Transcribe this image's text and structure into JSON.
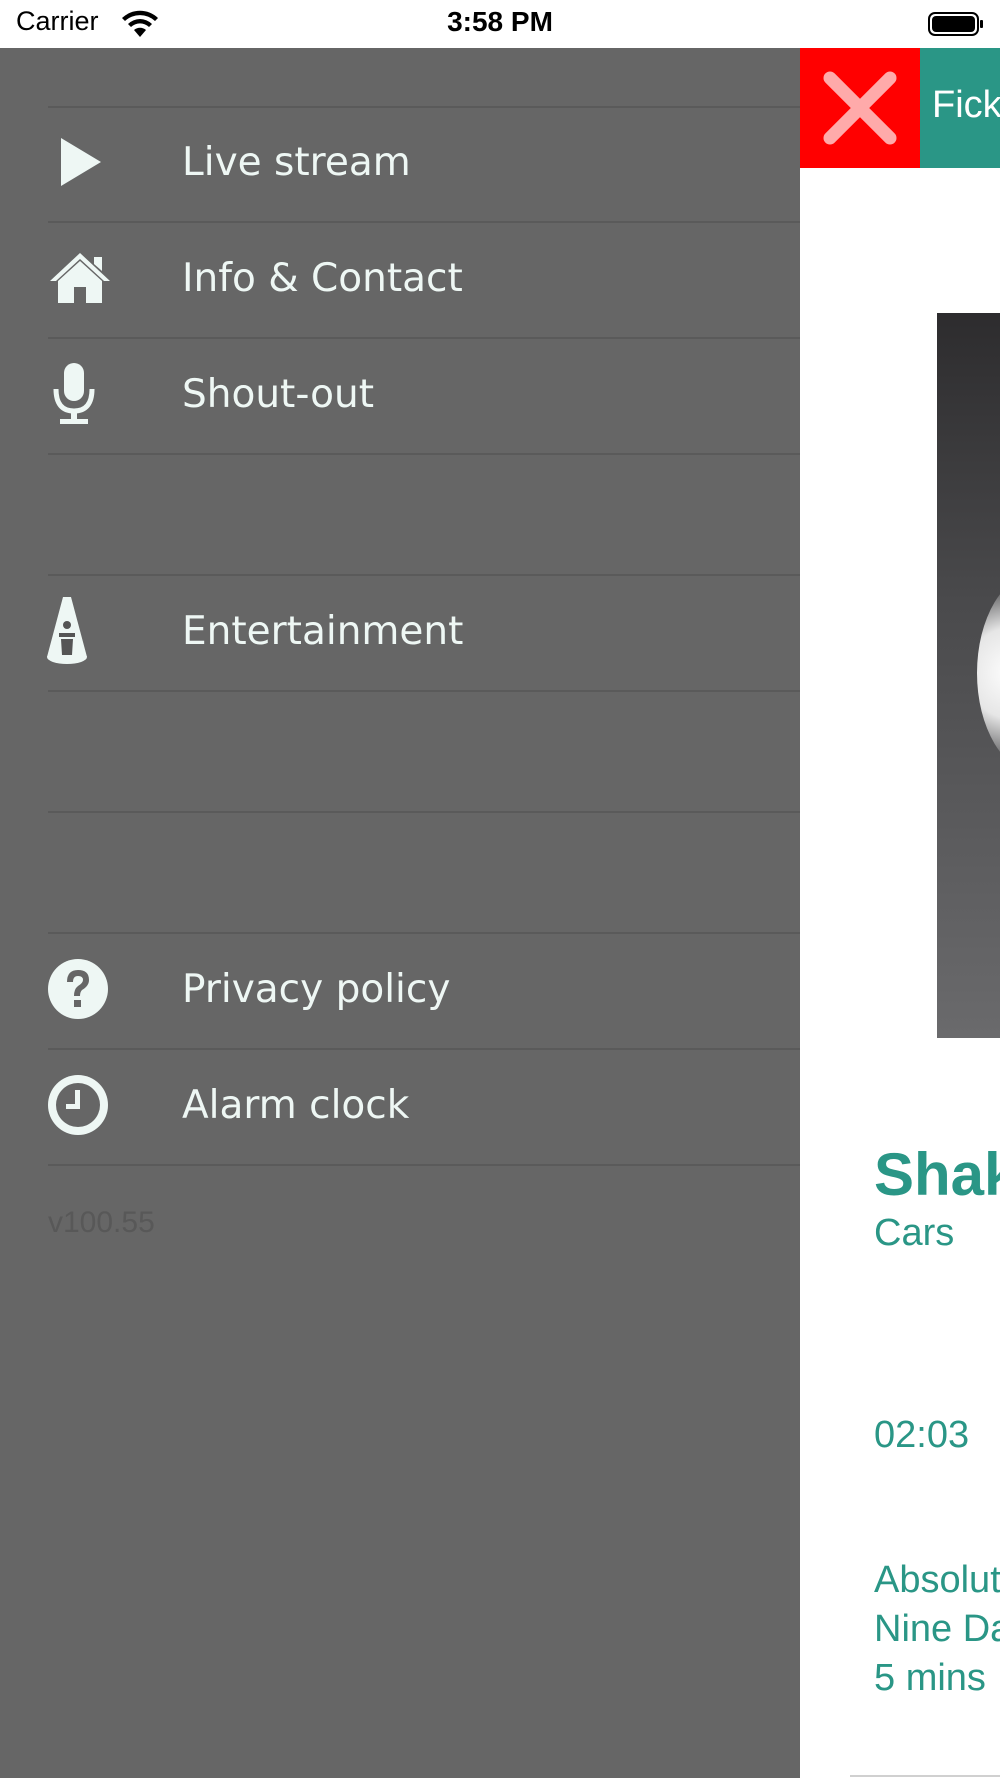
{
  "status_bar": {
    "carrier": "Carrier",
    "time": "3:58 PM"
  },
  "drawer": {
    "menu": [
      {
        "label": "Live stream",
        "icon": "play-icon"
      },
      {
        "label": "Info & Contact",
        "icon": "home-icon"
      },
      {
        "label": "Shout-out",
        "icon": "microphone-icon"
      },
      {
        "label": "",
        "icon": ""
      },
      {
        "label": "Entertainment",
        "icon": "spotlight-performer-icon"
      },
      {
        "label": "",
        "icon": ""
      },
      {
        "label": "",
        "icon": ""
      },
      {
        "label": "Privacy policy",
        "icon": "question-circle-icon"
      },
      {
        "label": "Alarm clock",
        "icon": "clock-icon"
      }
    ],
    "version": "v100.55"
  },
  "content": {
    "title_partial": "Fick",
    "now_playing": {
      "title_partial": "Shak",
      "artist": "Cars",
      "time": "02:03"
    },
    "next_lines": [
      "Absolut",
      "Nine Da",
      "5 mins"
    ]
  },
  "colors": {
    "drawer_bg": "#666666",
    "accent_teal": "#2a9686",
    "close_red": "#ff0000",
    "menu_text": "#eef7f4"
  }
}
